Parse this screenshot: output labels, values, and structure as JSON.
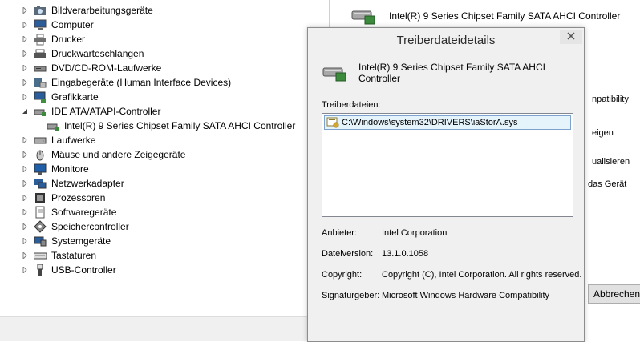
{
  "tree": {
    "items": [
      {
        "label": "Bildverarbeitungsgeräte",
        "icon": "camera-icon",
        "expanded": false
      },
      {
        "label": "Computer",
        "icon": "computer-icon",
        "expanded": false
      },
      {
        "label": "Drucker",
        "icon": "printer-icon",
        "expanded": false
      },
      {
        "label": "Druckwarteschlangen",
        "icon": "print-queue-icon",
        "expanded": false
      },
      {
        "label": "DVD/CD-ROM-Laufwerke",
        "icon": "dvd-drive-icon",
        "expanded": false
      },
      {
        "label": "Eingabegeräte (Human Interface Devices)",
        "icon": "hid-icon",
        "expanded": false
      },
      {
        "label": "Grafikkarte",
        "icon": "display-adapter-icon",
        "expanded": false
      },
      {
        "label": "IDE ATA/ATAPI-Controller",
        "icon": "ide-controller-icon",
        "expanded": true
      },
      {
        "label": "Intel(R) 9 Series Chipset Family SATA AHCI Controller",
        "icon": "sata-controller-icon",
        "child": true
      },
      {
        "label": "Laufwerke",
        "icon": "disk-drive-icon",
        "expanded": false
      },
      {
        "label": "Mäuse und andere Zeigegeräte",
        "icon": "mouse-icon",
        "expanded": false
      },
      {
        "label": "Monitore",
        "icon": "monitor-icon",
        "expanded": false
      },
      {
        "label": "Netzwerkadapter",
        "icon": "network-adapter-icon",
        "expanded": false
      },
      {
        "label": "Prozessoren",
        "icon": "processor-icon",
        "expanded": false
      },
      {
        "label": "Softwaregeräte",
        "icon": "software-device-icon",
        "expanded": false
      },
      {
        "label": "Speichercontroller",
        "icon": "storage-controller-icon",
        "expanded": false
      },
      {
        "label": "Systemgeräte",
        "icon": "system-device-icon",
        "expanded": false
      },
      {
        "label": "Tastaturen",
        "icon": "keyboard-icon",
        "expanded": false
      },
      {
        "label": "USB-Controller",
        "icon": "usb-icon",
        "expanded": false
      }
    ]
  },
  "background_window": {
    "device_name": "Intel(R) 9 Series Chipset Family SATA AHCI Controller",
    "fragments": [
      "npatibility",
      "eigen",
      "ualisieren",
      "das Gerät"
    ],
    "cancel_label": "Abbrechen"
  },
  "dialog": {
    "title": "Treiberdateidetails",
    "device_name": "Intel(R) 9 Series Chipset Family SATA AHCI Controller",
    "files_label": "Treiberdateien:",
    "files": [
      "C:\\Windows\\system32\\DRIVERS\\iaStorA.sys"
    ],
    "properties": [
      {
        "key": "Anbieter:",
        "value": "Intel Corporation"
      },
      {
        "key": "Dateiversion:",
        "value": "13.1.0.1058"
      },
      {
        "key": "Copyright:",
        "value": "Copyright (C), Intel Corporation. All rights reserved."
      },
      {
        "key": "Signaturgeber:",
        "value": "Microsoft Windows Hardware Compatibility"
      }
    ]
  },
  "colors": {
    "selection": "#e5f3fb",
    "selection_border": "#7da2ce",
    "dialog_bg": "#f0f0f0"
  }
}
